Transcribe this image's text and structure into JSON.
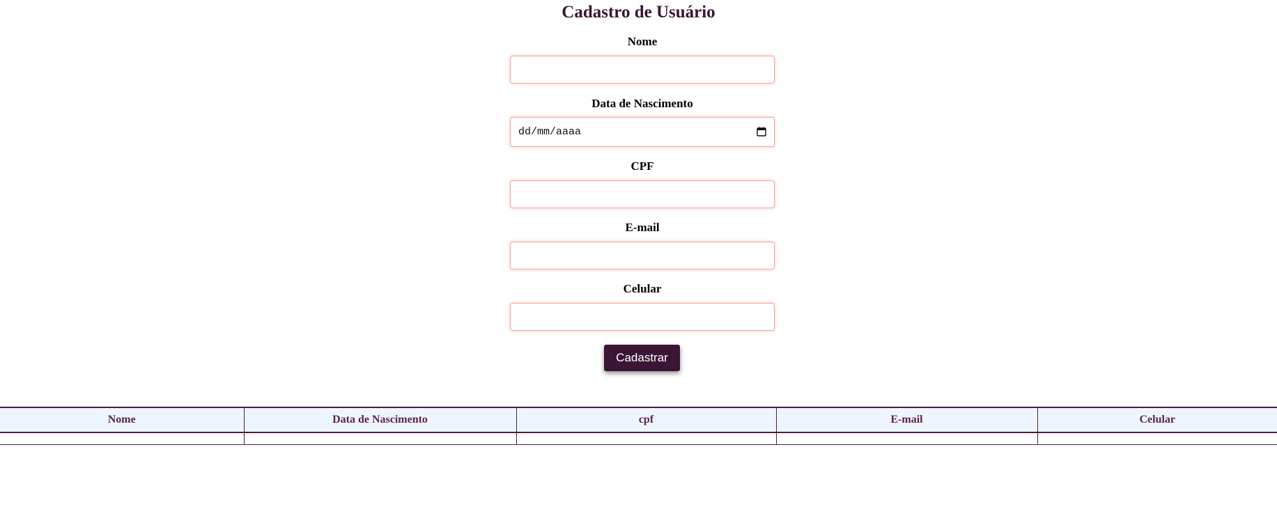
{
  "form": {
    "title": "Cadastro de Usuário",
    "fields": [
      {
        "label": "Nome",
        "value": "",
        "placeholder": ""
      },
      {
        "label": "Data de Nascimento",
        "value": "",
        "placeholder": "dd/mm/aaaa"
      },
      {
        "label": "CPF",
        "value": "",
        "placeholder": ""
      },
      {
        "label": "E-mail",
        "value": "",
        "placeholder": ""
      },
      {
        "label": "Celular",
        "value": "",
        "placeholder": ""
      }
    ],
    "submit_label": "Cadastrar"
  },
  "table": {
    "headers": [
      "Nome",
      "Data de Nascimento",
      "cpf",
      "E-mail",
      "Celular"
    ],
    "rows": [
      [
        "",
        "",
        "",
        "",
        ""
      ]
    ]
  },
  "colors": {
    "primary": "#3b1535",
    "table_header_bg": "#eef6fd",
    "table_header_text": "#5a2352",
    "input_border": "#f2a79f"
  },
  "icons": {
    "date_picker": "calendar-icon"
  }
}
